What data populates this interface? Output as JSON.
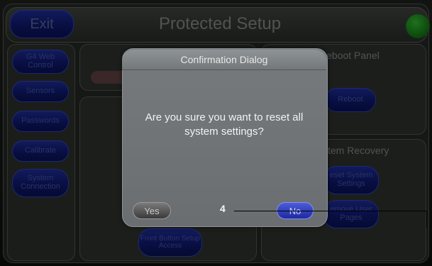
{
  "header": {
    "exit_label": "Exit",
    "title": "Protected Setup"
  },
  "left_nav": [
    {
      "label": "G4 Web Control"
    },
    {
      "label": "Sensors"
    },
    {
      "label": "Passwords"
    },
    {
      "label": "Calibrate"
    },
    {
      "label": "System Connection"
    }
  ],
  "background": {
    "reboot_panel_title": "Reboot Panel",
    "reboot_button": "Reboot",
    "system_recovery_title": "tem Recovery",
    "reset_system_settings_button": "eset System Settings",
    "remove_user_pages_button": "emove User Pages",
    "setup_access_button": "Front Button Setup Access"
  },
  "dialog": {
    "title": "Confirmation Dialog",
    "message": "Are you sure you want to reset all system settings?",
    "yes_label": "Yes",
    "no_label": "No"
  },
  "callout": {
    "number": "4"
  },
  "colors": {
    "accent_blue": "#1d2aa0",
    "status_light": "#136b13"
  }
}
